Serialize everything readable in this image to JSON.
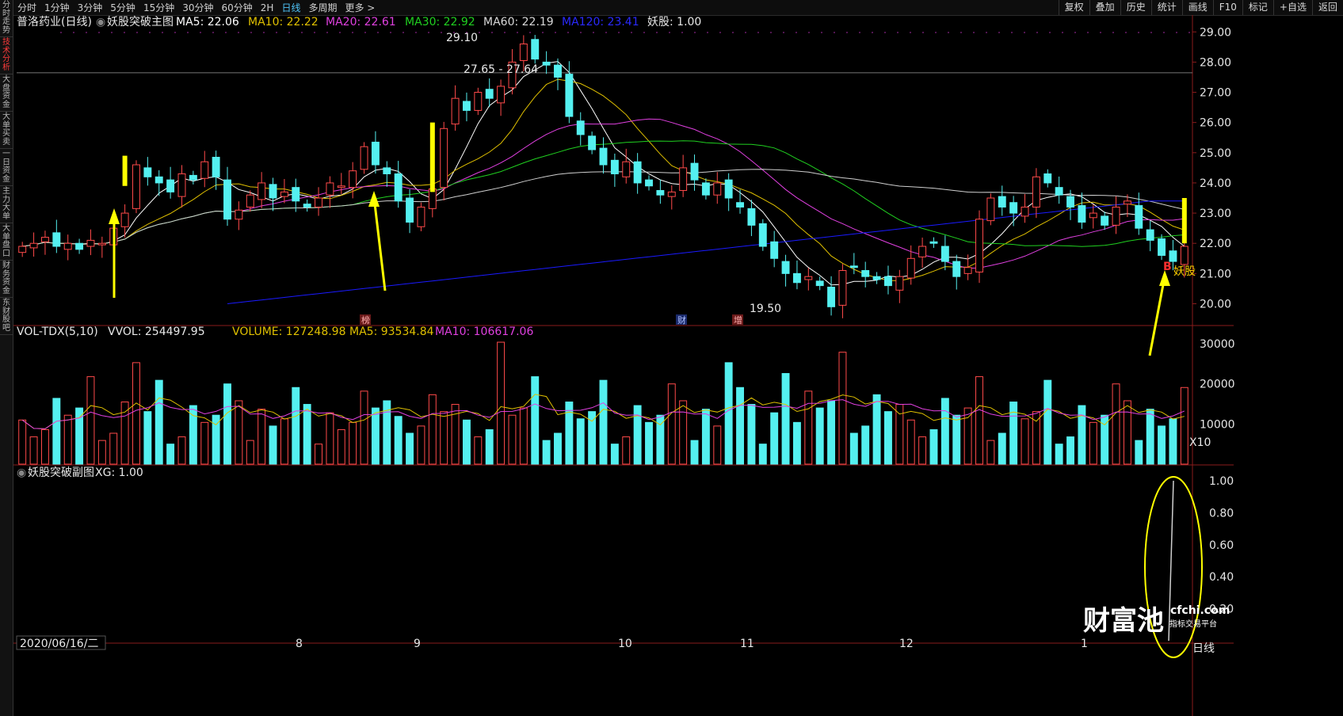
{
  "sidebar": [
    "分时走势",
    "技术分析",
    "大盘资金",
    "大单买卖",
    "一日资金",
    "主力大单",
    "大单盘口",
    "财务资金",
    "东财股吧"
  ],
  "sidebar_active": 1,
  "toolbar": {
    "periods": [
      "分时",
      "1分钟",
      "3分钟",
      "5分钟",
      "15分钟",
      "30分钟",
      "60分钟",
      "2H",
      "日线",
      "多周期",
      "更多 >"
    ],
    "active_period": "日线",
    "right_buttons": [
      "复权",
      "叠加",
      "历史",
      "统计",
      "画线",
      "F10",
      "标记",
      "+自选",
      "返回"
    ]
  },
  "main_legend": {
    "stock": "普洛药业(日线)",
    "indicator": "妖股突破主图",
    "ma5": "MA5: 22.06",
    "ma10": "MA10: 22.22",
    "ma20": "MA20: 22.61",
    "ma30": "MA30: 22.92",
    "ma60": "MA60: 22.19",
    "ma120": "MA120: 23.41",
    "yaogu": "妖股: 1.00"
  },
  "annotations": {
    "high": "29.10",
    "low": "19.50",
    "range": "27.65 - 27.64",
    "yaogu": "妖股",
    "buy": "B",
    "marks": [
      "榜",
      "财",
      "增"
    ]
  },
  "vol_legend": {
    "name": "VOL-TDX(5,10)",
    "vvol": "VVOL: 254497.95",
    "volume": "VOLUME: 127248.98",
    "ma5": "MA5: 93534.84",
    "ma10": "MA10: 106617.06",
    "unit": "X10"
  },
  "sub_legend": {
    "name": "妖股突破副图",
    "xg": "XG: 1.00"
  },
  "price_axis": [
    "29.00",
    "28.00",
    "27.00",
    "26.00",
    "25.00",
    "24.00",
    "23.00",
    "22.00",
    "21.00",
    "20.00"
  ],
  "vol_axis": [
    "30000",
    "20000",
    "10000"
  ],
  "sub_axis": [
    "1.00",
    "0.80",
    "0.60",
    "0.40",
    "0.20"
  ],
  "x_axis": {
    "date": "2020/06/16/二",
    "months": [
      "8",
      "9",
      "10",
      "11",
      "12",
      "1"
    ],
    "right": "日线"
  },
  "watermark": {
    "brand": "财富池",
    "url": "cfchi.com",
    "tagline": "指标交易平台"
  },
  "colors": {
    "up": "#ff4a4a",
    "down": "#54f0f0",
    "ma5": "#ffffff",
    "ma10": "#e0c000",
    "ma20": "#e040e0",
    "ma30": "#20d020",
    "ma60": "#cfcfcf",
    "ma120": "#1a1aff",
    "signal": "#ffff00"
  },
  "chart_data": {
    "type": "candlestick",
    "title": "普洛药业(日线)",
    "price_range": [
      19.2,
      29.4
    ],
    "closes_approx": [
      21.9,
      22.0,
      22.2,
      21.9,
      22.0,
      21.8,
      22.1,
      22.0,
      22.5,
      23.0,
      24.6,
      24.2,
      24.0,
      23.7,
      24.3,
      24.1,
      24.7,
      24.2,
      22.8,
      23.1,
      23.6,
      24.0,
      23.5,
      23.7,
      23.4,
      23.2,
      23.5,
      24.0,
      23.9,
      24.4,
      25.2,
      24.6,
      24.3,
      23.4,
      22.7,
      23.2,
      23.8,
      25.8,
      26.8,
      26.4,
      27.0,
      26.8,
      27.2,
      28.0,
      28.6,
      28.1,
      27.9,
      27.5,
      26.2,
      25.6,
      25.1,
      24.6,
      24.3,
      24.7,
      24.0,
      23.9,
      23.6,
      23.7,
      24.5,
      24.1,
      23.6,
      24.0,
      23.5,
      23.2,
      22.6,
      21.9,
      21.5,
      21.0,
      20.7,
      20.9,
      20.6,
      19.9,
      21.1,
      21.2,
      20.9,
      20.8,
      20.6,
      20.9,
      21.5,
      21.9,
      22.0,
      21.4,
      20.9,
      21.2,
      22.8,
      23.5,
      23.2,
      23.0,
      23.2,
      24.2,
      24.0,
      23.6,
      23.2,
      22.7,
      23.0,
      22.6,
      23.2,
      23.4,
      22.5,
      22.1,
      21.6,
      21.4,
      21.9
    ],
    "yaogu_signal_value": 1.0,
    "volume_range": [
      0,
      31000
    ],
    "volume_ticks": [
      10000,
      20000,
      30000
    ],
    "sub_range": [
      0,
      1.0
    ]
  }
}
